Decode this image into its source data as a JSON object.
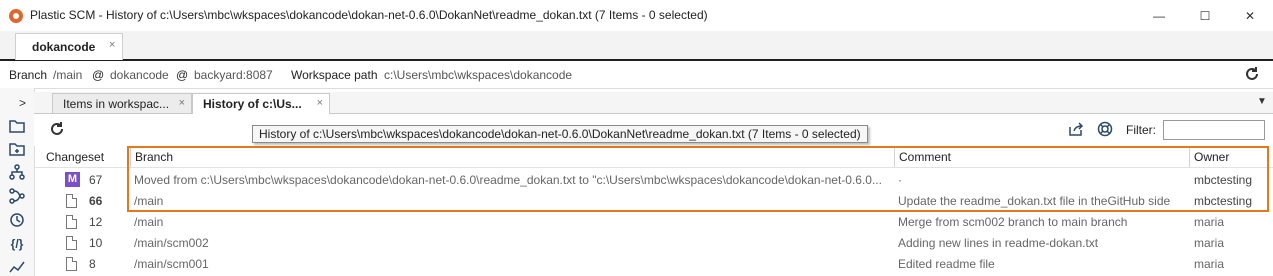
{
  "window": {
    "title": "Plastic SCM - History of c:\\Users\\mbc\\wkspaces\\dokancode\\dokan-net-0.6.0\\DokanNet\\readme_dokan.txt (7 Items - 0 selected)",
    "minimize": "—",
    "maximize": "☐",
    "close": "✕"
  },
  "workspace_tab": {
    "label": "dokancode",
    "close": "×"
  },
  "infobar": {
    "branch_label": "Branch",
    "branch_value": "/main",
    "at1": "@",
    "repo": "dokancode",
    "at2": "@",
    "server": "backyard:8087",
    "path_label": "Workspace path",
    "path_value": "c:\\Users\\mbc\\wkspaces\\dokancode"
  },
  "rail": {
    "expand": ">",
    "icons": [
      "folder-icon",
      "pending-changes-icon",
      "branch-explorer-icon",
      "branches-icon",
      "history-icon",
      "code-review-icon",
      "chart-icon"
    ]
  },
  "view_tabs": [
    {
      "label": "Items in workspac...",
      "close": "×"
    },
    {
      "label": "History of c:\\Us...",
      "close": "×"
    }
  ],
  "view_tabs_menu": "▼",
  "toolbar": {
    "filter_label": "Filter:",
    "filter_value": ""
  },
  "tooltip": "History of c:\\Users\\mbc\\wkspaces\\dokancode\\dokan-net-0.6.0\\DokanNet\\readme_dokan.txt (7 Items - 0 selected)",
  "table": {
    "headers": {
      "changeset": "Changeset",
      "branch": "Branch",
      "comment": "Comment",
      "owner": "Owner"
    },
    "rows": [
      {
        "icon": "M",
        "changeset": "67",
        "branch": "Moved from c:\\Users\\mbc\\wkspaces\\dokancode\\dokan-net-0.6.0\\readme_dokan.txt to \"c:\\Users\\mbc\\wkspaces\\dokancode\\dokan-net-0.6.0...",
        "comment": "·",
        "owner": "mbctesting"
      },
      {
        "icon": "",
        "changeset": "66",
        "branch": "/main",
        "comment": "Update the readme_dokan.txt file in theGitHub side",
        "owner": "mbctesting"
      },
      {
        "icon": "",
        "changeset": "12",
        "branch": "/main",
        "comment": "Merge from scm002 branch to main branch",
        "owner": "maria"
      },
      {
        "icon": "",
        "changeset": "10",
        "branch": "/main/scm002",
        "comment": "Adding new lines in readme-dokan.txt",
        "owner": "maria"
      },
      {
        "icon": "",
        "changeset": "8",
        "branch": "/main/scm001",
        "comment": "Edited readme file",
        "owner": "maria"
      }
    ]
  },
  "colors": {
    "highlight": "#e07a1d",
    "merge_badge": "#7a4fc7",
    "accent": "#e0662c"
  }
}
